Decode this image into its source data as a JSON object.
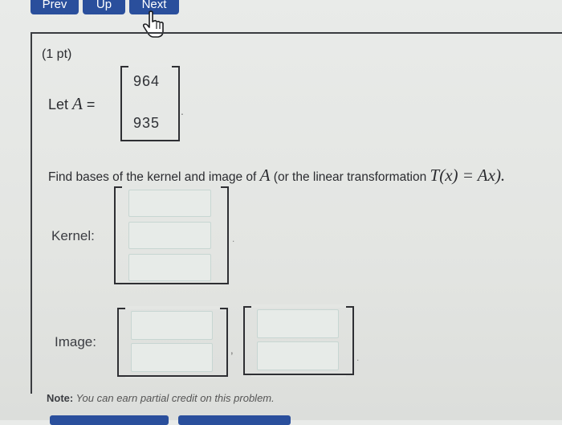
{
  "nav": {
    "prev_label": "Prev",
    "up_label": "Up",
    "next_label": "Next"
  },
  "problem": {
    "points": "(1 pt)",
    "let_prefix": "Let ",
    "matrix_var": "A",
    "equals": " =",
    "matrix_rows": [
      "964",
      "935"
    ],
    "matrix_period": ".",
    "find_text": "Find bases of the kernel and image of ",
    "find_var": "A",
    "find_paren": " (or the linear transformation ",
    "transform_expr": "T(x) = Ax).",
    "kernel_label": "Kernel:",
    "image_label": "Image:",
    "kernel_inputs": [
      "",
      "",
      ""
    ],
    "image_inputs_1": [
      "",
      ""
    ],
    "image_inputs_2": [
      "",
      ""
    ]
  },
  "note": {
    "prefix": "Note:",
    "text": " You can earn partial credit on this problem."
  },
  "icons": {
    "cursor": "hand-pointer-icon"
  },
  "colors": {
    "nav_button": "#2a4f9c",
    "input_border": "#c7d6d2"
  }
}
